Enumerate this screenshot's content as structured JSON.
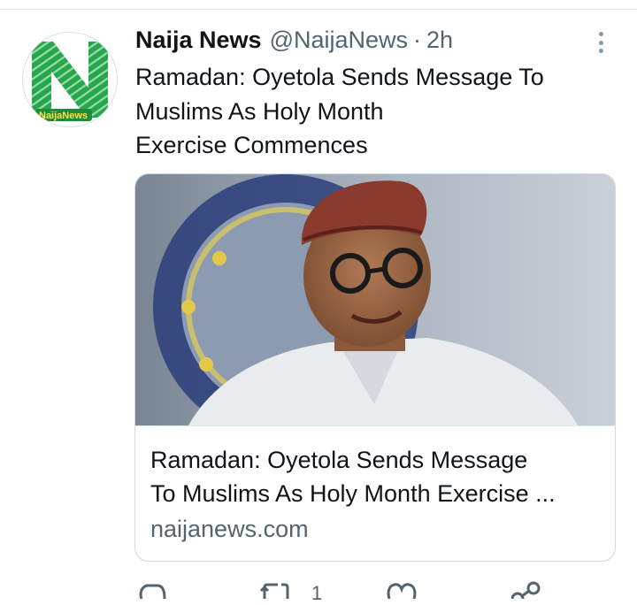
{
  "tweet": {
    "author_name": "Naija News",
    "author_handle": "@NaijaNews",
    "separator": "·",
    "timestamp": "2h",
    "text_lines": [
      "Ramadan: Oyetola Sends Message To",
      "Muslims As Holy Month",
      "Exercise Commences"
    ],
    "avatar_logo_text": "NaijaNews",
    "avatar_icon": "naija-news-logo",
    "more_icon": "vertical-dots-icon"
  },
  "card": {
    "title_lines": [
      "Ramadan: Oyetola Sends Message",
      "To Muslims As Holy Month Exercise ..."
    ],
    "domain": "naijanews.com",
    "image_alt": "Man in white outfit with glasses and a traditional cap"
  },
  "actions": {
    "reply": {
      "icon": "reply-icon"
    },
    "retweet": {
      "icon": "retweet-icon",
      "count": "1"
    },
    "like": {
      "icon": "heart-icon"
    },
    "share": {
      "icon": "share-icon"
    }
  },
  "colors": {
    "text_primary": "#0f1419",
    "text_secondary": "#536471",
    "brand_green": "#22a24a",
    "card_border": "#cfd9de"
  }
}
